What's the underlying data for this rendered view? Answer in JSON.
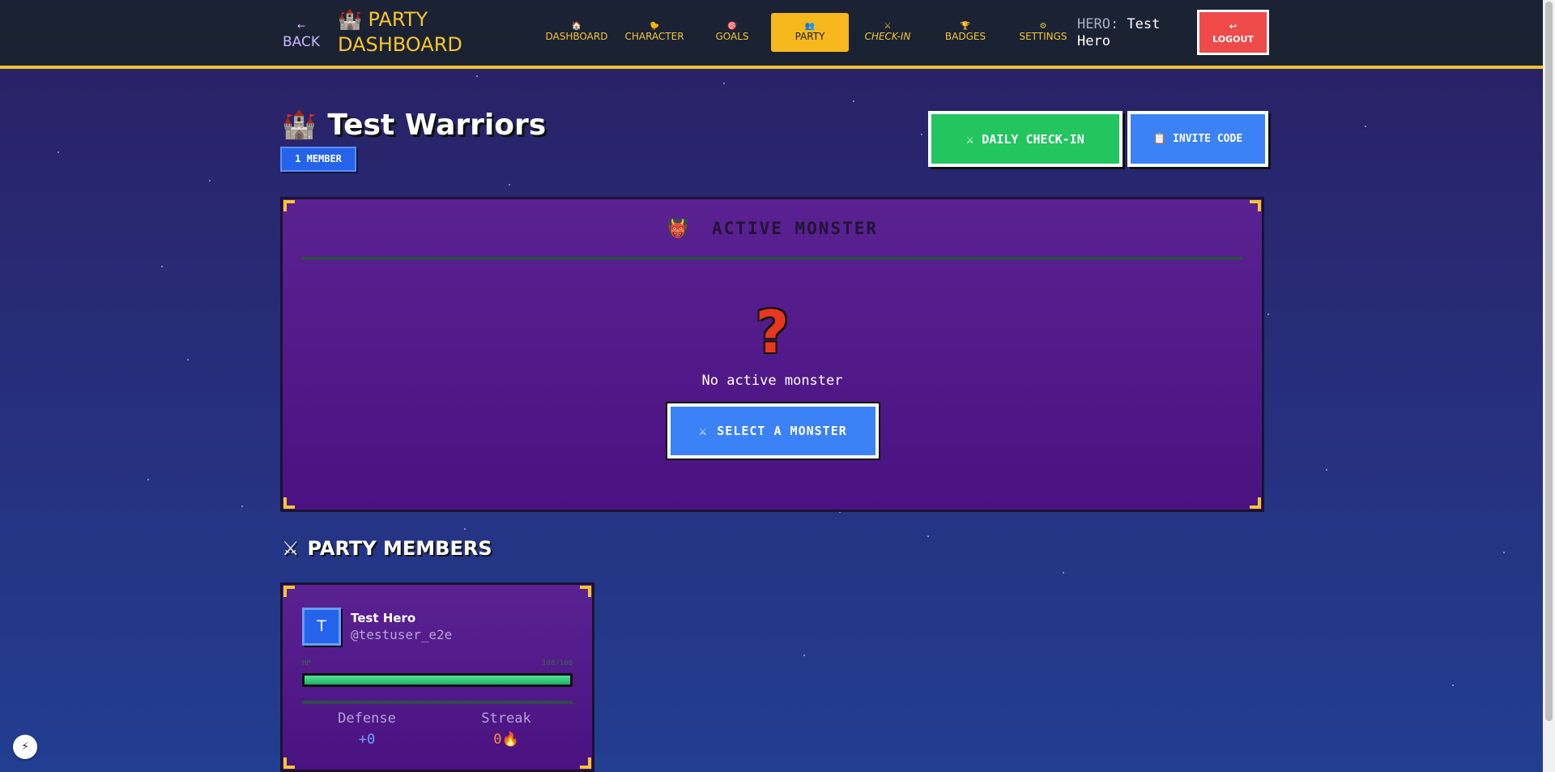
{
  "header": {
    "back_arrow": "←",
    "back_label": "BACK",
    "brand_icon": "🏰",
    "brand_title": "PARTY DASHBOARD",
    "nav": [
      {
        "icon": "🏠",
        "label": "DASHBOARD"
      },
      {
        "icon": "🐤",
        "label": "CHARACTER"
      },
      {
        "icon": "🎯",
        "label": "GOALS"
      },
      {
        "icon": "👥",
        "label": "PARTY"
      },
      {
        "icon": "⚔",
        "label": "CHECK-IN"
      },
      {
        "icon": "🏆",
        "label": "BADGES"
      },
      {
        "icon": "⚙",
        "label": "SETTINGS"
      }
    ],
    "active_tab": "PARTY",
    "hero_key": "HERO:",
    "hero_name": "Test Hero",
    "logout_icon": "↩",
    "logout_label": "LOGOUT"
  },
  "party": {
    "icon": "🏰",
    "name": "Test Warriors",
    "member_badge": "1 MEMBER",
    "daily_checkin": {
      "icon": "⚔",
      "label": "DAILY CHECK-IN"
    },
    "invite_code": {
      "icon": "📋",
      "label": "INVITE CODE"
    }
  },
  "monster": {
    "icon": "👹",
    "title": "ACTIVE MONSTER",
    "placeholder_icon": "?",
    "status": "No active monster",
    "select_button": {
      "icon": "⚔",
      "label": "SELECT A MONSTER"
    }
  },
  "members_section": {
    "icon": "⚔",
    "title": "PARTY MEMBERS",
    "members": [
      {
        "avatar_letter": "T",
        "name": "Test Hero",
        "username": "@testuser_e2e",
        "hp_label": "HP",
        "hp_text": "100/100",
        "hp_fraction": 1.0,
        "defense_label": "Defense",
        "defense_value": "+0",
        "streak_label": "Streak",
        "streak_value": "0🔥"
      }
    ]
  },
  "colors": {
    "accent_gold": "#f6c531",
    "primary_blue": "#3b82f6",
    "success_green": "#22c55e",
    "danger_red": "#ef4a4a",
    "panel_purple": "#5a2191"
  },
  "fab_icon": "⚡"
}
